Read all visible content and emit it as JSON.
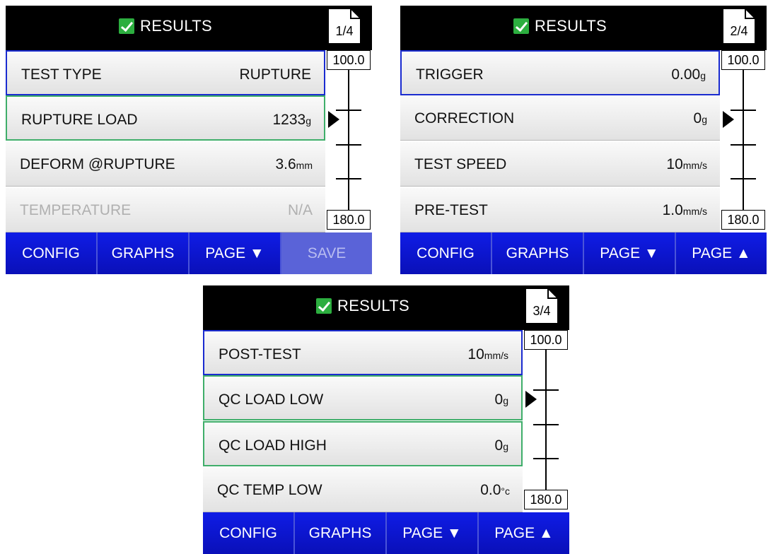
{
  "panels": [
    {
      "title": "RESULTS",
      "page": "1/4",
      "scale": {
        "top": "100.0",
        "bottom": "180.0"
      },
      "rows": [
        {
          "label": "TEST TYPE",
          "value": "RUPTURE",
          "unit": ""
        },
        {
          "label": "RUPTURE LOAD",
          "value": "1233",
          "unit": "g"
        },
        {
          "label": "DEFORM @RUPTURE",
          "value": "3.6",
          "unit": "mm"
        },
        {
          "label": "TEMPERATURE",
          "value": "N/A",
          "unit": ""
        }
      ],
      "buttons": [
        "CONFIG",
        "GRAPHS",
        "PAGE ▼",
        "SAVE"
      ]
    },
    {
      "title": "RESULTS",
      "page": "2/4",
      "scale": {
        "top": "100.0",
        "bottom": "180.0"
      },
      "rows": [
        {
          "label": "TRIGGER",
          "value": "0.00",
          "unit": "g"
        },
        {
          "label": "CORRECTION",
          "value": "0",
          "unit": "g"
        },
        {
          "label": "TEST SPEED",
          "value": "10",
          "unit": "mm/s"
        },
        {
          "label": "PRE-TEST",
          "value": "1.0",
          "unit": "mm/s"
        }
      ],
      "buttons": [
        "CONFIG",
        "GRAPHS",
        "PAGE ▼",
        "PAGE ▲"
      ]
    },
    {
      "title": "RESULTS",
      "page": "3/4",
      "scale": {
        "top": "100.0",
        "bottom": "180.0"
      },
      "rows": [
        {
          "label": "POST-TEST",
          "value": "10",
          "unit": "mm/s"
        },
        {
          "label": "QC LOAD LOW",
          "value": "0",
          "unit": "g"
        },
        {
          "label": "QC LOAD HIGH",
          "value": "0",
          "unit": "g"
        },
        {
          "label": "QC TEMP LOW",
          "value": "0.0",
          "unit": "°c"
        }
      ],
      "buttons": [
        "CONFIG",
        "GRAPHS",
        "PAGE ▼",
        "PAGE ▲"
      ]
    }
  ],
  "icons": {
    "header": "checkmark-icon",
    "badge": "page-document-icon",
    "scale": "scale-pointer-icon"
  },
  "colors": {
    "accent_blue": "#1a2bd0",
    "accent_green": "#3fae6a",
    "button_blue": "#0f1ce6",
    "check_green": "#2cae3f"
  }
}
